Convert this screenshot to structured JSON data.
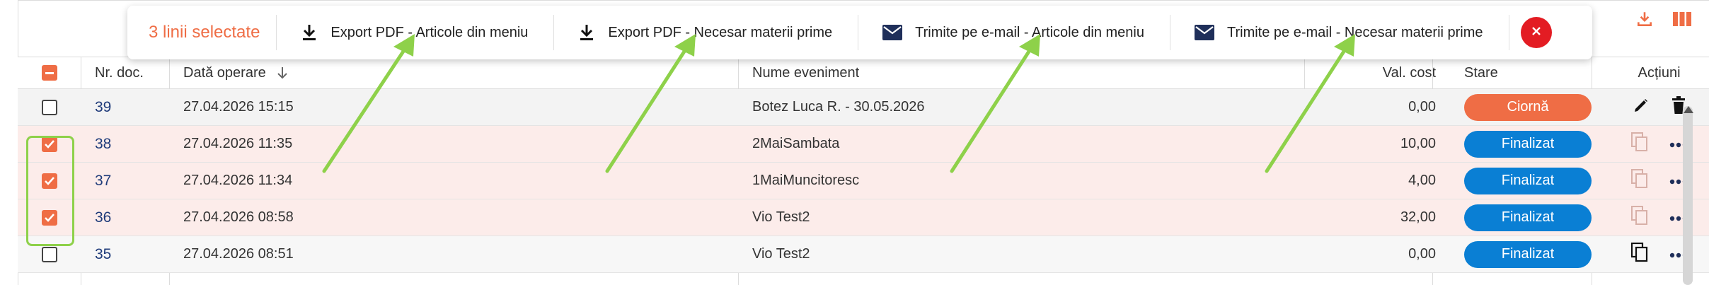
{
  "bulk_bar": {
    "selected_text": "3 linii selectate",
    "actions": [
      {
        "label": "Export PDF - Articole din meniu",
        "icon": "download-icon"
      },
      {
        "label": "Export PDF - Necesar materii prime",
        "icon": "download-icon"
      },
      {
        "label": "Trimite pe e-mail - Articole din meniu",
        "icon": "mail-icon"
      },
      {
        "label": "Trimite pe e-mail - Necesar materii prime",
        "icon": "mail-icon"
      }
    ],
    "close_icon": "close-icon"
  },
  "columns": {
    "nr": "Nr. doc.",
    "date": "Dată operare",
    "name": "Nume eveniment",
    "cost": "Val. cost",
    "state": "Stare",
    "actions": "Acțiuni"
  },
  "rows": [
    {
      "nr": "39",
      "date": "27.04.2026 15:15",
      "name": "Botez Luca R. - 30.05.2026",
      "cost": "0,00",
      "state": "Ciornă",
      "selected": false
    },
    {
      "nr": "38",
      "date": "27.04.2026 11:35",
      "name": "2MaiSambata",
      "cost": "10,00",
      "state": "Finalizat",
      "selected": true
    },
    {
      "nr": "37",
      "date": "27.04.2026 11:34",
      "name": "1MaiMuncitoresc",
      "cost": "4,00",
      "state": "Finalizat",
      "selected": true
    },
    {
      "nr": "36",
      "date": "27.04.2026 08:58",
      "name": "Vio Test2",
      "cost": "32,00",
      "state": "Finalizat",
      "selected": true
    },
    {
      "nr": "35",
      "date": "27.04.2026 08:51",
      "name": "Vio Test2",
      "cost": "0,00",
      "state": "Finalizat",
      "selected": false
    }
  ],
  "colors": {
    "accent": "#ef6d45",
    "status_done": "#0a7fd4",
    "link": "#1f3b7a",
    "annotation": "#8ed14a"
  }
}
